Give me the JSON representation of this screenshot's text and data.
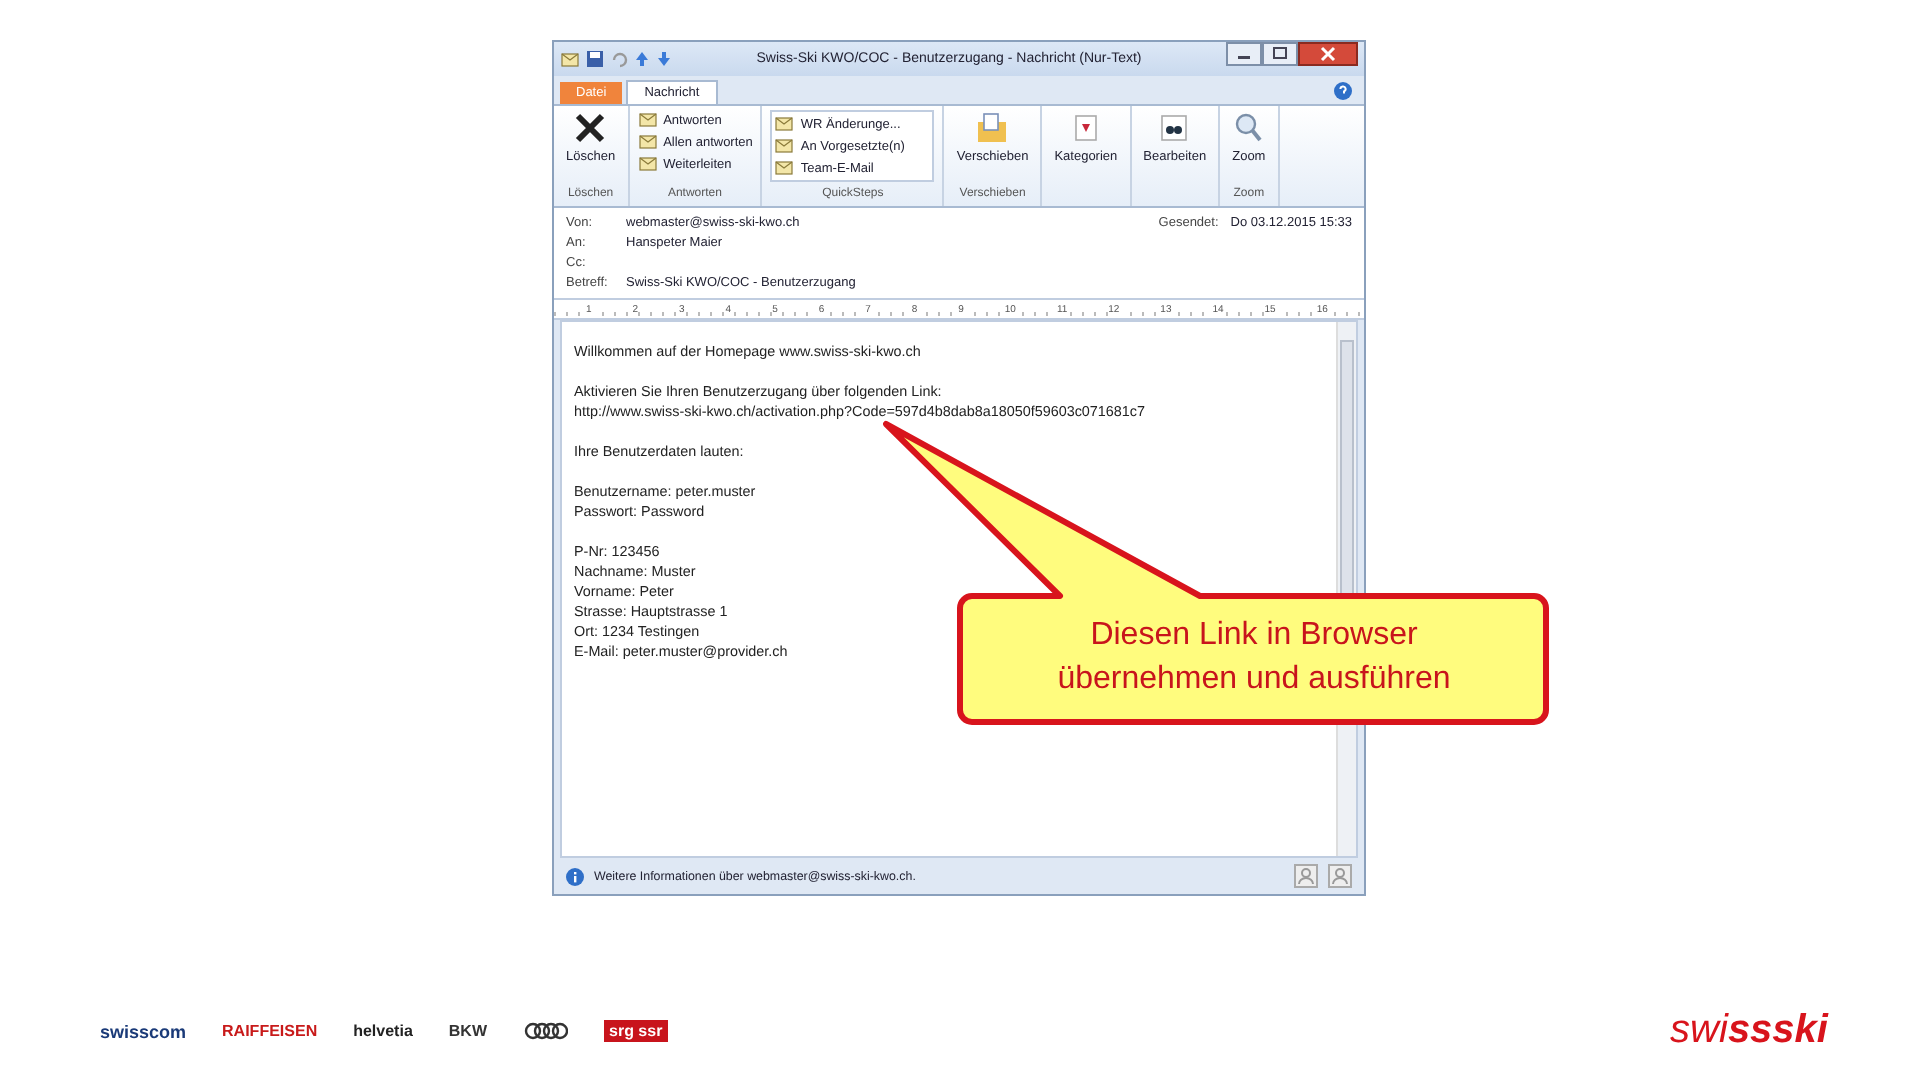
{
  "window": {
    "title": "Swiss-Ski KWO/COC - Benutzerzugang - Nachricht (Nur-Text)"
  },
  "tabs": [
    {
      "label": "Datei",
      "selected": false,
      "kind": "file"
    },
    {
      "label": "Nachricht",
      "selected": true,
      "kind": "normal"
    }
  ],
  "ribbon": {
    "groups": [
      {
        "label": "Löschen",
        "items": [
          {
            "kind": "delete",
            "label": "Löschen"
          }
        ]
      },
      {
        "label": "Antworten",
        "items": [
          {
            "kind": "small",
            "label": "Antworten"
          },
          {
            "kind": "small",
            "label": "Allen antworten"
          },
          {
            "kind": "small",
            "label": "Weiterleiten"
          }
        ]
      },
      {
        "label": "QuickSteps",
        "items": [
          {
            "kind": "quick",
            "label": "WR Änderunge..."
          },
          {
            "kind": "quick",
            "label": "An Vorgesetzte(n)"
          },
          {
            "kind": "quick",
            "label": "Team-E-Mail"
          }
        ]
      },
      {
        "label": "Verschieben",
        "items": [
          {
            "kind": "move",
            "label": "Verschieben"
          }
        ]
      },
      {
        "items": [
          {
            "kind": "categorize",
            "label": "Kategorien"
          }
        ]
      },
      {
        "items": [
          {
            "kind": "find",
            "label": "Bearbeiten"
          }
        ]
      },
      {
        "label": "Zoom",
        "items": [
          {
            "kind": "zoom",
            "label": "Zoom"
          }
        ]
      }
    ]
  },
  "header": {
    "fields": [
      {
        "label": "Von:",
        "value": "webmaster@swiss-ski-kwo.ch"
      },
      {
        "label": "An:",
        "value": "Hanspeter Maier"
      },
      {
        "label": "Cc:"
      },
      {
        "label": "Betreff:",
        "value": "Swiss-Ski KWO/COC - Benutzerzugang"
      }
    ],
    "sent_label": "Gesendet:",
    "sent_value": "Do 03.12.2015 15:33"
  },
  "ruler": {
    "marks": [
      "1",
      "2",
      "3",
      "4",
      "5",
      "6",
      "7",
      "8",
      "9",
      "10",
      "11",
      "12",
      "13",
      "14",
      "15",
      "16"
    ]
  },
  "body": {
    "paragraphs": [
      [
        "Willkommen auf der Homepage www.swiss-ski-kwo.ch"
      ],
      [
        "Aktivieren Sie Ihren Benutzerzugang über folgenden Link:",
        "http://www.swiss-ski-kwo.ch/activation.php?Code=597d4b8dab8a18050f59603c071681c7"
      ],
      [
        "Ihre Benutzerdaten lauten:"
      ],
      [
        "Benutzername: peter.muster",
        "Passwort: Password"
      ],
      [
        "P-Nr: 123456",
        "Nachname: Muster",
        "Vorname: Peter",
        "Strasse: Hauptstrasse 1",
        "Ort:  1234 Testingen",
        "E-Mail: peter.muster@provider.ch"
      ]
    ]
  },
  "status_bar": {
    "text": "Weitere Informationen über webmaster@swiss-ski-kwo.ch."
  },
  "callout": {
    "lines": [
      "Diesen Link in Browser",
      "übernehmen und ausführen"
    ]
  },
  "sponsors": [
    "swisscom",
    "RAIFFEISEN",
    "helvetia",
    "BKW",
    "srg ssr"
  ],
  "logo": "swi**ssski**"
}
